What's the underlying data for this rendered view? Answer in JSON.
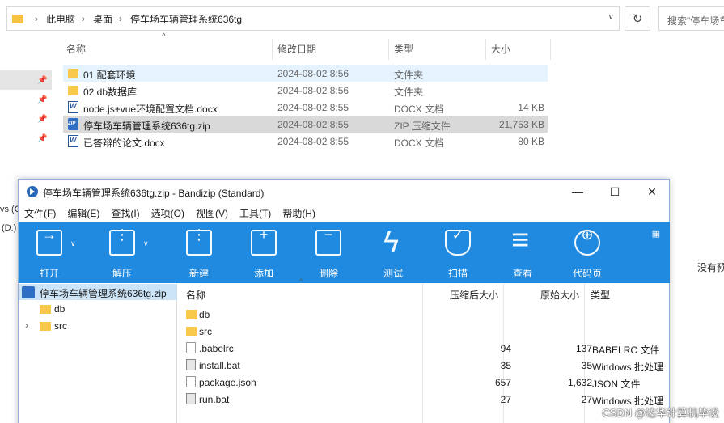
{
  "explorer": {
    "breadcrumb": [
      "此电脑",
      "桌面",
      "停车场车辆管理系统636tg"
    ],
    "search_placeholder": "搜索\"停车场车",
    "columns": {
      "name": "名称",
      "date": "修改日期",
      "type": "类型",
      "size": "大小"
    },
    "files": [
      {
        "name": "01  配套环境",
        "date": "2024-08-02 8:56",
        "type": "文件夹",
        "size": "",
        "icon": "folder-icon"
      },
      {
        "name": "02 db数据库",
        "date": "2024-08-02 8:56",
        "type": "文件夹",
        "size": "",
        "icon": "folder-icon"
      },
      {
        "name": "node.js+vue环境配置文档.docx",
        "date": "2024-08-02 8:55",
        "type": "DOCX 文档",
        "size": "14 KB",
        "icon": "word-doc-icon"
      },
      {
        "name": "停车场车辆管理系统636tg.zip",
        "date": "2024-08-02 8:55",
        "type": "ZIP 压缩文件",
        "size": "21,753 KB",
        "icon": "zip-icon"
      },
      {
        "name": "已答辩的论文.docx",
        "date": "2024-08-02 8:55",
        "type": "DOCX 文档",
        "size": "80 KB",
        "icon": "word-doc-icon"
      }
    ],
    "side_partial": [
      "vs (C",
      "(D:)"
    ],
    "right_partial": "没有预"
  },
  "bandizip": {
    "title": "停车场车辆管理系统636tg.zip - Bandizip (Standard)",
    "menu": [
      "文件(F)",
      "编辑(E)",
      "查找(I)",
      "选项(O)",
      "视图(V)",
      "工具(T)",
      "帮助(H)"
    ],
    "toolbar": [
      "打开",
      "解压",
      "新建",
      "添加",
      "删除",
      "测试",
      "扫描",
      "查看",
      "代码页"
    ],
    "tree": {
      "root": "停车场车辆管理系统636tg.zip",
      "children": [
        "db",
        "src"
      ]
    },
    "columns": {
      "name": "名称",
      "compressed": "压缩后大小",
      "original": "原始大小",
      "type": "类型"
    },
    "entries": [
      {
        "name": "db",
        "compressed": "",
        "original": "",
        "type": "",
        "icon": "folder-icon"
      },
      {
        "name": "src",
        "compressed": "",
        "original": "",
        "type": "",
        "icon": "folder-icon"
      },
      {
        "name": ".babelrc",
        "compressed": "94",
        "original": "137",
        "type": "BABELRC 文件",
        "icon": "file-icon"
      },
      {
        "name": "install.bat",
        "compressed": "35",
        "original": "35",
        "type": "Windows 批处理",
        "icon": "bat-file-icon"
      },
      {
        "name": "package.json",
        "compressed": "657",
        "original": "1,632",
        "type": "JSON 文件",
        "icon": "file-icon"
      },
      {
        "name": "run.bat",
        "compressed": "27",
        "original": "27",
        "type": "Windows 批处理",
        "icon": "bat-file-icon"
      }
    ]
  },
  "watermark": "CSDN @达华计算机毕设"
}
